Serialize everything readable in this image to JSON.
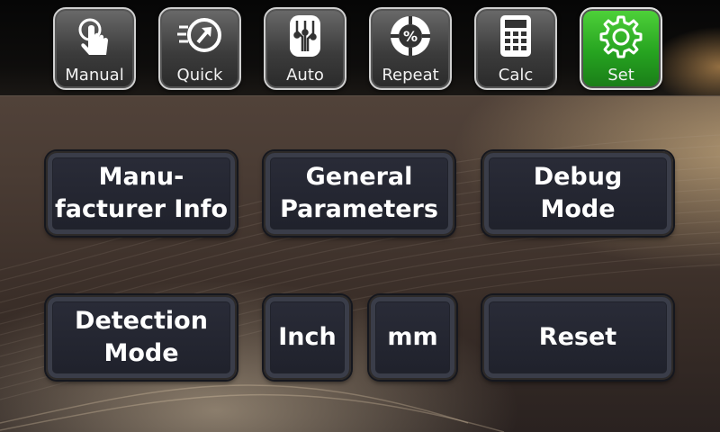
{
  "nav": [
    {
      "label": "Manual",
      "icon": "hand-pointer-icon",
      "active": false
    },
    {
      "label": "Quick",
      "icon": "fast-forward-arrow-icon",
      "active": false
    },
    {
      "label": "Auto",
      "icon": "circuit-chip-icon",
      "active": false
    },
    {
      "label": "Repeat",
      "icon": "percent-dial-icon",
      "active": false
    },
    {
      "label": "Calc",
      "icon": "calculator-icon",
      "active": false
    },
    {
      "label": "Set",
      "icon": "gear-icon",
      "active": true
    }
  ],
  "settings": {
    "manufacturer_line1": "Manu-",
    "manufacturer_line2": "facturer Info",
    "general_line1": "General",
    "general_line2": "Parameters",
    "debug_line1": "Debug",
    "debug_line2": "Mode",
    "detection_line1": "Detection",
    "detection_line2": "Mode",
    "inch": "Inch",
    "mm": "mm",
    "reset": "Reset"
  },
  "colors": {
    "active_tab": "#2aa524",
    "button_face": "#23252f",
    "text": "#ffffff"
  }
}
